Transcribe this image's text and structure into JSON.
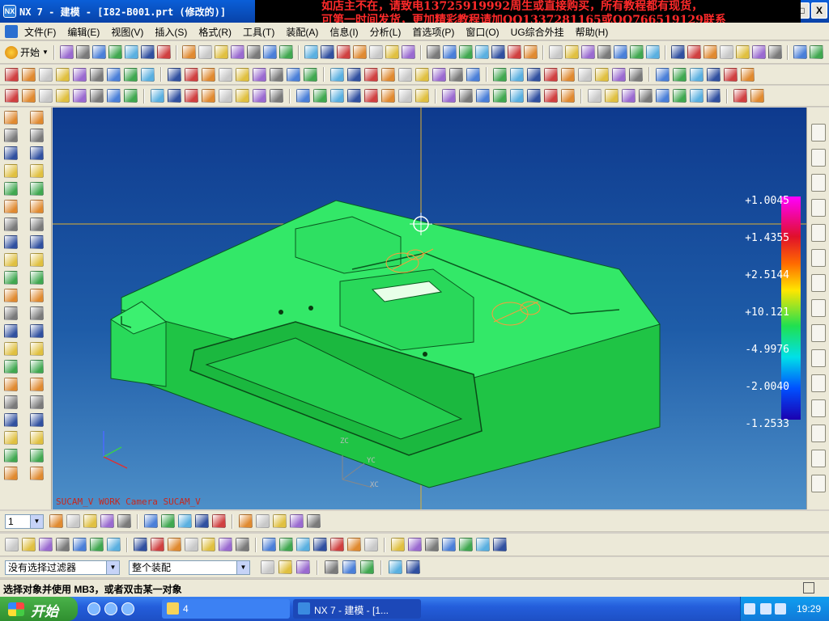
{
  "window": {
    "title": "NX 7 - 建模 - [I82-B001.prt  (修改的)]",
    "controls": [
      "_",
      "□",
      "X"
    ]
  },
  "banner": {
    "line1": "如店主不在，请致电13725919992周生或直接购买，所有教程都有现货，",
    "line2": "可第一时间发货，更加精彩教程请加QQ1337281165或QQ766519129联系"
  },
  "menu": {
    "items": [
      "文件(F)",
      "编辑(E)",
      "视图(V)",
      "插入(S)",
      "格式(R)",
      "工具(T)",
      "装配(A)",
      "信息(I)",
      "分析(L)",
      "首选项(P)",
      "窗口(O)",
      "UG综合外挂",
      "帮助(H)"
    ]
  },
  "toolbar1": {
    "start_label": "开始"
  },
  "legend": {
    "values": [
      "+1.0045",
      "+1.4355",
      "+2.5144",
      "+10.121",
      "-4.9976",
      "-2.0040",
      "-1.2533"
    ]
  },
  "viewport": {
    "label": "SUCAM_V WORK  Camera SUCAM_V",
    "axis_z": "ZC",
    "axis_y": "YC",
    "axis_x": "XC"
  },
  "snap": {
    "layer_value": "1"
  },
  "selection": {
    "filter": "没有选择过滤器",
    "scope": "整个装配"
  },
  "status": {
    "prompt": "选择对象并使用 MB3，或者双击某一对象"
  },
  "taskbar": {
    "start": "开始",
    "folder_task": "4",
    "nx_task": "NX 7 - 建模 - [1...",
    "clock": "19:29"
  },
  "colors": {
    "part_green": "#2ee65e",
    "viewport_top": "#0e3a8e",
    "viewport_bottom": "#4d8fc8",
    "banner_text": "#ff2a2a"
  }
}
